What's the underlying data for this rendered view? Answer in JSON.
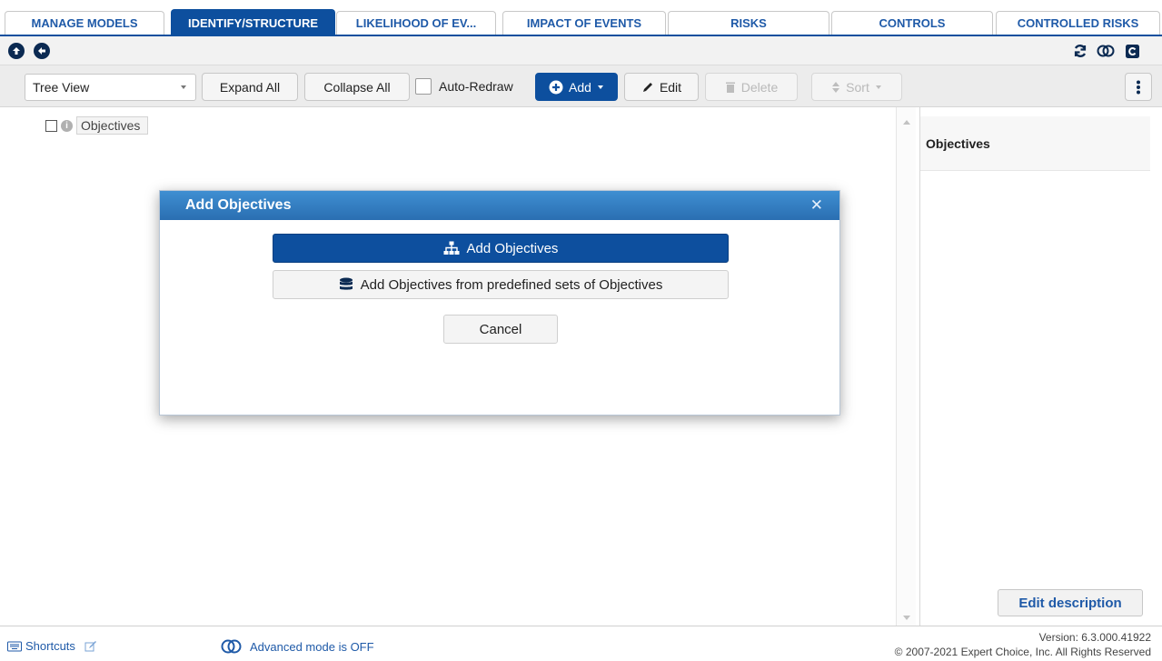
{
  "tabs": [
    {
      "label": "MANAGE MODELS",
      "active": false
    },
    {
      "label": "IDENTIFY/STRUCTURE",
      "active": true
    },
    {
      "label": "LIKELIHOOD OF EV...",
      "active": false
    },
    {
      "label": "IMPACT OF EVENTS",
      "active": false
    },
    {
      "label": "RISKS",
      "active": false
    },
    {
      "label": "CONTROLS",
      "active": false
    },
    {
      "label": "CONTROLLED RISKS",
      "active": false
    }
  ],
  "toolbar": {
    "view_select": "Tree View",
    "expand_all": "Expand All",
    "collapse_all": "Collapse All",
    "auto_redraw": "Auto-Redraw",
    "add": "Add",
    "edit": "Edit",
    "delete": "Delete",
    "sort": "Sort"
  },
  "tree": {
    "root_label": "Objectives"
  },
  "side_panel": {
    "title": "Objectives",
    "edit_description": "Edit description"
  },
  "modal": {
    "title": "Add Objectives",
    "add_objectives": "Add Objectives",
    "add_from_sets": "Add Objectives from predefined sets of Objectives",
    "cancel": "Cancel"
  },
  "footer": {
    "shortcuts": "Shortcuts",
    "advanced_mode": "Advanced mode is OFF",
    "version": "Version: 6.3.000.41922",
    "copyright": "© 2007-2021 Expert Choice, Inc. All Rights Reserved"
  },
  "colors": {
    "primary": "#0d4f9e",
    "modal_header": "#2a6fb2",
    "link": "#1f5aa8"
  }
}
